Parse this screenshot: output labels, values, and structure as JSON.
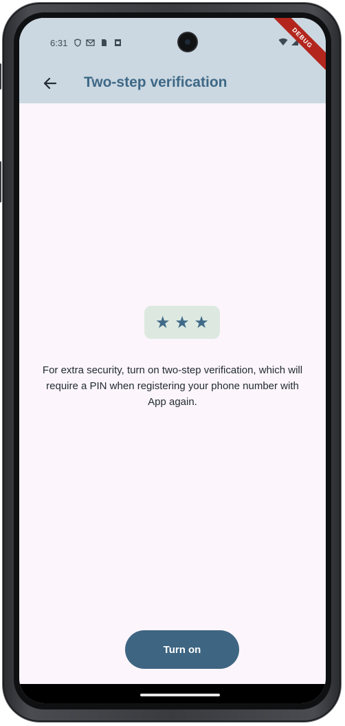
{
  "status_bar": {
    "time": "6:31",
    "left_icons": [
      "shield-icon",
      "gmail-icon",
      "sim-icon",
      "notification-icon"
    ],
    "right_icons": [
      "wifi-icon",
      "signal-icon",
      "battery-icon"
    ],
    "debug_label": "DEBUG"
  },
  "app_bar": {
    "back_icon": "arrow-left-icon",
    "title": "Two-step verification"
  },
  "main": {
    "stars_icon": "three-stars-icon",
    "stars_glyph": "★ ★ ★",
    "description": "For extra security, turn on two-step verification, which will require a PIN when registering your phone number with App again.",
    "primary_button_label": "Turn on"
  },
  "colors": {
    "app_bar_bg": "#cbd8e1",
    "title": "#3e6886",
    "background": "#fcf5fb",
    "button": "#3e6582",
    "stars_bg": "#dde9e0",
    "debug_ribbon": "#b3261e"
  }
}
